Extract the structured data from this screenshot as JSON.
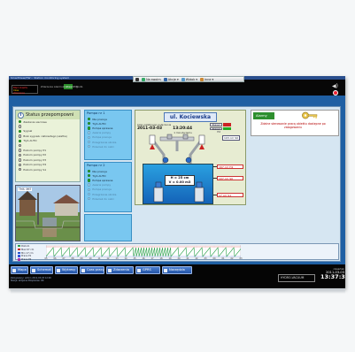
{
  "window": {
    "title_strip": "SmartView/HW :: Station monitoring system",
    "alarm_header": "Zdarzenia Alarmowe: ALARMY",
    "alarm_lines": [
      "Błąd obiektu",
      "Czas",
      "Zdarzenie"
    ],
    "green_button": "Ustaw",
    "station_tag": "godz."
  },
  "toolbar": {
    "items": [
      {
        "label": "",
        "icon": "close-icon"
      },
      {
        "label": "Na swoim",
        "icon": "pointer-icon"
      },
      {
        "label": "Akcje",
        "icon": "actions-icon"
      },
      {
        "label": "Widok",
        "icon": "view-icon"
      },
      {
        "label": "Inne",
        "icon": "other-icon"
      }
    ]
  },
  "status_panel": {
    "title": "Status przepompowni",
    "items": [
      {
        "label": "Zasilanie sieciowe",
        "on": true
      },
      {
        "label": "",
        "on": false
      },
      {
        "label": "Sygnał",
        "on": true
      },
      {
        "label": "Brak sygnału całkowitego (szafka)",
        "on": false
      },
      {
        "label": "Tryb AUTO",
        "on": true
      },
      {
        "label": "",
        "on": false
      },
      {
        "label": "Poziom pompy P1",
        "on": false
      },
      {
        "label": "Poziom pompy P2",
        "on": false
      },
      {
        "label": "Poziom pompy P3",
        "on": false
      },
      {
        "label": "Poziom pompy P4",
        "on": false
      },
      {
        "label": "Poziom pompy S1",
        "on": false
      }
    ]
  },
  "photo": {
    "label": "TMS 3MT"
  },
  "pump1": {
    "title": "Pompa nr 1",
    "items": [
      {
        "label": "Nie pracuje",
        "on": true,
        "dim": false
      },
      {
        "label": "Tryb AUTO",
        "on": true,
        "dim": false
      },
      {
        "label": "Pompa sprawna",
        "on": true,
        "dim": false
      },
      {
        "label": "Awaria pompy",
        "on": false,
        "dim": true
      },
      {
        "label": "Pompa pracuje",
        "on": false,
        "dim": true
      },
      {
        "label": "Przegrzanie silnika",
        "on": false,
        "dim": true
      },
      {
        "label": "Przeciek do celki",
        "on": false,
        "dim": true
      }
    ]
  },
  "pump2": {
    "title": "Pompa nr 2",
    "items": [
      {
        "label": "Nie pracuje",
        "on": true,
        "dim": false
      },
      {
        "label": "Tryb AUTO",
        "on": true,
        "dim": false
      },
      {
        "label": "Pompa sprawna",
        "on": true,
        "dim": false
      },
      {
        "label": "Awaria pompy",
        "on": false,
        "dim": true
      },
      {
        "label": "Pompa pracuje",
        "on": false,
        "dim": true
      },
      {
        "label": "Przegrzanie silnika",
        "on": false,
        "dim": true
      },
      {
        "label": "Przeciek do celki",
        "on": false,
        "dim": true
      }
    ]
  },
  "schematic": {
    "station_name": "ul. Kociewska",
    "time_label": "Czas ostatniego połączenia",
    "time_value": "13:20:44",
    "date_value": "2011-03-03",
    "interval_label": "1 minuta temu",
    "levels": [
      {
        "label": "Poziom H1",
        "value": "",
        "green": false
      },
      {
        "label": "Poziom H2",
        "value": "",
        "green": true
      }
    ],
    "value_cm": "103 cm S0",
    "tank_h": "H = 25 cm",
    "tank_v": "V = 0.00 m3",
    "markers": [
      {
        "label": "167 cm H1"
      },
      {
        "label": "107 cm S0"
      },
      {
        "label": "17 cm S1"
      }
    ]
  },
  "alarm_panel": {
    "button": "Alarmy",
    "message": "Zdalne sterowanie pracą obiektu dostępne po zalogowaniu"
  },
  "trend": {
    "legend": [
      {
        "label": "Poziom",
        "color": "#2aa14a"
      },
      {
        "label": "Max 67 cm",
        "color": "#cc2222"
      },
      {
        "label": "Min 17 cm",
        "color": "#2255cc"
      },
      {
        "label": "Praca P1",
        "color": "#3355dd"
      },
      {
        "label": "Praca P2",
        "color": "#aa33aa"
      }
    ],
    "x_ticks": [
      "05",
      "06",
      "07",
      "08",
      "09",
      "10",
      "11",
      "12",
      "13",
      "14",
      "15",
      "16",
      "17",
      "18",
      "19",
      "20",
      "21",
      "22",
      "23",
      "00",
      "01",
      "02",
      "03"
    ]
  },
  "bottom_nav": {
    "buttons": [
      {
        "label": "Mapa",
        "icon": "map-icon"
      },
      {
        "label": "Schemat",
        "icon": "schema-icon"
      },
      {
        "label": "Wykresy",
        "icon": "chart-icon"
      },
      {
        "label": "Czas pracy",
        "icon": "clock-icon"
      },
      {
        "label": "Zdarzenia",
        "icon": "events-icon"
      },
      {
        "label": "GPRS",
        "icon": "gprs-icon"
      },
      {
        "label": "Narzędzia",
        "icon": "tools-icon"
      }
    ],
    "status_lines": [
      "Zalogowany: admin  2011-03-03 12:00",
      "Stacja: aktywna  Połączenie: OK"
    ],
    "logo": "HYDRO-VACUUM",
    "day": "czwartek",
    "date": "2011-03-03",
    "time": "13:37:36"
  }
}
